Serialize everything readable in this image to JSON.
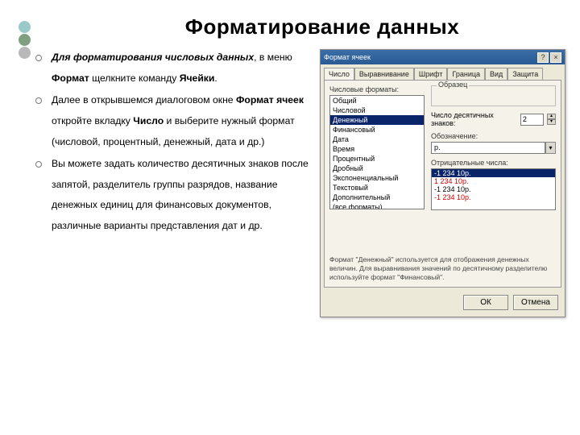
{
  "title": "Форматирование  данных",
  "bullets": {
    "b1_a": "Для  форматирования  числовых  данных",
    "b1_b": ",  в  меню  ",
    "b1_c": "Формат",
    "b1_d": "  щелкните  команду  ",
    "b1_e": "Ячейки",
    "b1_f": ".",
    "b2_a": "Далее  в  открывшемся  диалоговом  окне  ",
    "b2_b": "Формат  ячеек",
    "b2_c": "  откройте  вкладку  ",
    "b2_d": "Число",
    "b2_e": "  и  выберите  нужный  формат  (числовой,  процентный,  денежный,  дата  и  др.)",
    "b3": "Вы  можете  задать  количество  десятичных  знаков  после  запятой,  разделитель  группы  разрядов,  название  денежных  единиц  для  финансовых  документов,  различные  варианты  представления  дат  и  др."
  },
  "dialog": {
    "title": "Формат ячеек",
    "tabs": [
      "Число",
      "Выравнивание",
      "Шрифт",
      "Граница",
      "Вид",
      "Защита"
    ],
    "formatsLabel": "Числовые форматы:",
    "formats": [
      "Общий",
      "Числовой",
      "Денежный",
      "Финансовый",
      "Дата",
      "Время",
      "Процентный",
      "Дробный",
      "Экспоненциальный",
      "Текстовый",
      "Дополнительный",
      "(все форматы)"
    ],
    "sampleLabel": "Образец",
    "decLabel": "Число десятичных знаков:",
    "decValue": "2",
    "denomLabel": "Обозначение:",
    "denomValue": "р.",
    "negLabel": "Отрицательные числа:",
    "neg": [
      "-1 234  10р.",
      "1 234  10р.",
      "-1 234  10р.",
      "-1 234  10р."
    ],
    "hint": "Формат \"Денежный\" используется для отображения денежных величин. Для выравнивания значений по десятичному разделителю используйте формат \"Финансовый\".",
    "ok": "ОК",
    "cancel": "Отмена"
  }
}
